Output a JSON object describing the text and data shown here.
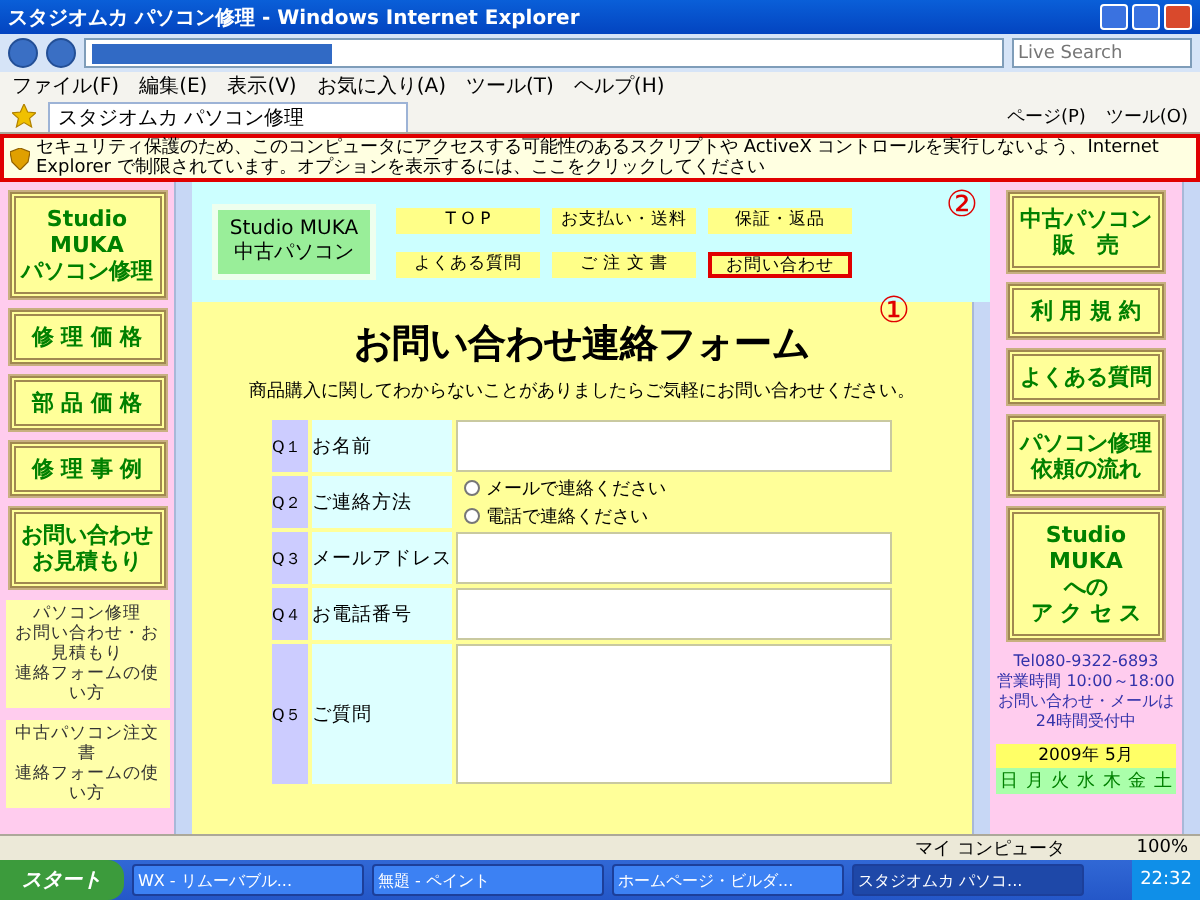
{
  "window": {
    "title": "スタジオムカ パソコン修理 - Windows Internet Explorer"
  },
  "search": {
    "placeholder": "Live Search"
  },
  "menu": [
    "ファイル(F)",
    "編集(E)",
    "表示(V)",
    "お気に入り(A)",
    "ツール(T)",
    "ヘルプ(H)"
  ],
  "tab": {
    "label": "スタジオムカ パソコン修理"
  },
  "toolbar": [
    "ページ(P)",
    "ツール(O)"
  ],
  "infobar": {
    "text": "セキュリティ保護のため、このコンピュータにアクセスする可能性のあるスクリプトや ActiveX コントロールを実行しないよう、Internet Explorer で制限されています。オプションを表示するには、ここをクリックしてください",
    "highlighted": true
  },
  "left_sidebar": {
    "buttons": [
      [
        "Studio MUKA",
        "パソコン修理"
      ],
      [
        "修 理 価 格"
      ],
      [
        "部 品 価 格"
      ],
      [
        "修 理 事 例"
      ],
      [
        "お問い合わせ",
        "お見積もり"
      ]
    ],
    "notes": [
      [
        "パソコン修理",
        "お問い合わせ・お見積もり",
        "連絡フォームの使い方"
      ],
      [
        "中古パソコン注文書",
        "連絡フォームの使い方"
      ]
    ]
  },
  "header": {
    "logo": [
      "Studio MUKA",
      "中古パソコン"
    ],
    "nav": [
      {
        "label": "T O P",
        "highlighted": false
      },
      {
        "label": "お支払い・送料",
        "highlighted": false
      },
      {
        "label": "保証・返品",
        "highlighted": false
      },
      {
        "label": "よくある質問",
        "highlighted": false
      },
      {
        "label": "ご 注 文 書",
        "highlighted": false
      },
      {
        "label": "お問い合わせ",
        "highlighted": true
      }
    ],
    "marks": [
      "②",
      "①"
    ]
  },
  "form": {
    "title": "お問い合わせ連絡フォーム",
    "intro": "商品購入に関してわからないことがありましたらご気軽にお問い合わせください。",
    "rows": [
      {
        "number": "Q１",
        "label": "お名前",
        "kind": "text"
      },
      {
        "number": "Q２",
        "label": "ご連絡方法",
        "kind": "radio",
        "options": [
          {
            "label": "メールで連絡ください",
            "checked": false
          },
          {
            "label": "電話で連絡ください",
            "checked": false
          }
        ]
      },
      {
        "number": "Q３",
        "label": "メールアドレス",
        "kind": "text"
      },
      {
        "number": "Q４",
        "label": "お電話番号",
        "kind": "text"
      },
      {
        "number": "Q５",
        "label": "ご質問",
        "kind": "textarea"
      }
    ]
  },
  "right_sidebar": {
    "buttons": [
      [
        "中古パソコン",
        "販　売"
      ],
      [
        "利 用 規 約"
      ],
      [
        "よくある質問"
      ],
      [
        "パソコン修理",
        "依頼の流れ"
      ],
      [
        "Studio MUKA",
        "への",
        "ア ク セ ス"
      ]
    ],
    "info": [
      "Tel080-9322-6893",
      "営業時間 10:00～18:00",
      "お問い合わせ・メールは24時間受付中"
    ],
    "calendar": {
      "title": "2009年 5月",
      "weekdays": [
        "日",
        "月",
        "火",
        "水",
        "木",
        "金",
        "土"
      ]
    }
  },
  "status_bar": {
    "zone": "マイ コンピュータ",
    "zoom": "100%"
  },
  "taskbar": {
    "start": "スタート",
    "tasks": [
      {
        "label": "WX - リムーバブル...",
        "selected": false
      },
      {
        "label": "無題 - ペイント",
        "selected": false
      },
      {
        "label": "ホームページ・ビルダ...",
        "selected": false
      },
      {
        "label": "スタジオムカ パソコ...",
        "selected": true
      }
    ],
    "clock": "22:32"
  }
}
